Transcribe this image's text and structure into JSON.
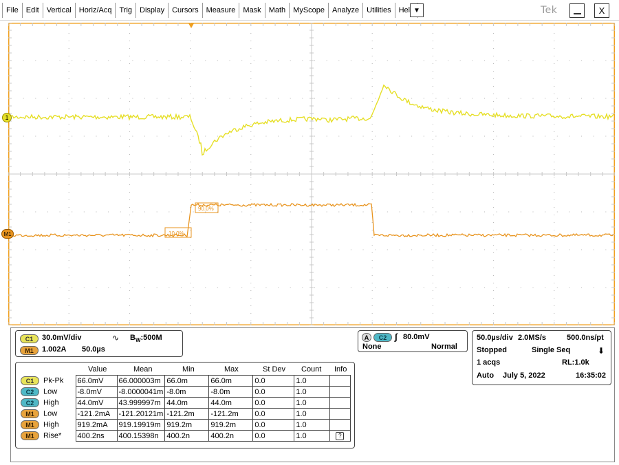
{
  "menu": {
    "items": [
      "File",
      "Edit",
      "Vertical",
      "Horiz/Acq",
      "Trig",
      "Display",
      "Cursors",
      "Measure",
      "Mask",
      "Math",
      "MyScope",
      "Analyze",
      "Utilities",
      "Help"
    ],
    "dropdown_glyph": "▼",
    "brand": "Tek",
    "minimize_glyph": "__",
    "close_glyph": "X"
  },
  "colors": {
    "ch1": "#e6df27",
    "math1": "#e8941f",
    "graticule_frame": "#f0a020",
    "grid_dots": "#b4b4b4"
  },
  "waveform": {
    "ch1_marker": "1",
    "m1_marker": "M1",
    "rise_ref_labels": [
      "10.0%",
      "90.0%"
    ]
  },
  "channel_panel": {
    "c1_badge": "C1",
    "c1_scale": "30.0mV/div",
    "coupling_glyph": "∿",
    "bw_prefix": "B",
    "bw_sub": "W",
    "bw_value": ":500M",
    "m1_badge": "M1",
    "m1_scale": "1.002A",
    "m1_time": "50.0µs"
  },
  "trigger_panel": {
    "a_badge": "A",
    "source_badge": "C2",
    "slope_glyph": "∫",
    "level": "80.0mV",
    "coupling": "None",
    "mode": "Normal"
  },
  "acq_panel": {
    "timebase": "50.0µs/div",
    "sample_rate": "2.0MS/s",
    "resolution": "500.0ns/pt",
    "state": "Stopped",
    "sequence": "Single Seq",
    "acqs": "1 acqs",
    "record_length": "RL:1.0k",
    "trigger_mode": "Auto",
    "date": "July 5, 2022",
    "time": "16:35:02",
    "arrow_glyph": "⬇"
  },
  "measurements": {
    "headers": [
      "Value",
      "Mean",
      "Min",
      "Max",
      "St Dev",
      "Count",
      "Info"
    ],
    "rows": [
      {
        "badge": "C1",
        "kind": "c1",
        "label": "Pk-Pk",
        "value": "66.0mV",
        "mean": "66.000003m",
        "min": "66.0m",
        "max": "66.0m",
        "stdev": "0.0",
        "count": "1.0"
      },
      {
        "badge": "C2",
        "kind": "c2",
        "label": "Low",
        "value": "-8.0mV",
        "mean": "-8.0000041m",
        "min": "-8.0m",
        "max": "-8.0m",
        "stdev": "0.0",
        "count": "1.0"
      },
      {
        "badge": "C2",
        "kind": "c2",
        "label": "High",
        "value": "44.0mV",
        "mean": "43.999997m",
        "min": "44.0m",
        "max": "44.0m",
        "stdev": "0.0",
        "count": "1.0"
      },
      {
        "badge": "M1",
        "kind": "m1",
        "label": "Low",
        "value": "-121.2mA",
        "mean": "-121.20121m",
        "min": "-121.2m",
        "max": "-121.2m",
        "stdev": "0.0",
        "count": "1.0"
      },
      {
        "badge": "M1",
        "kind": "m1",
        "label": "High",
        "value": "919.2mA",
        "mean": "919.19919m",
        "min": "919.2m",
        "max": "919.2m",
        "stdev": "0.0",
        "count": "1.0"
      },
      {
        "badge": "M1",
        "kind": "m1",
        "label": "Rise*",
        "value": "400.2ns",
        "mean": "400.15398n",
        "min": "400.2n",
        "max": "400.2n",
        "stdev": "0.0",
        "count": "1.0"
      }
    ],
    "info_icon_glyph": "?"
  }
}
